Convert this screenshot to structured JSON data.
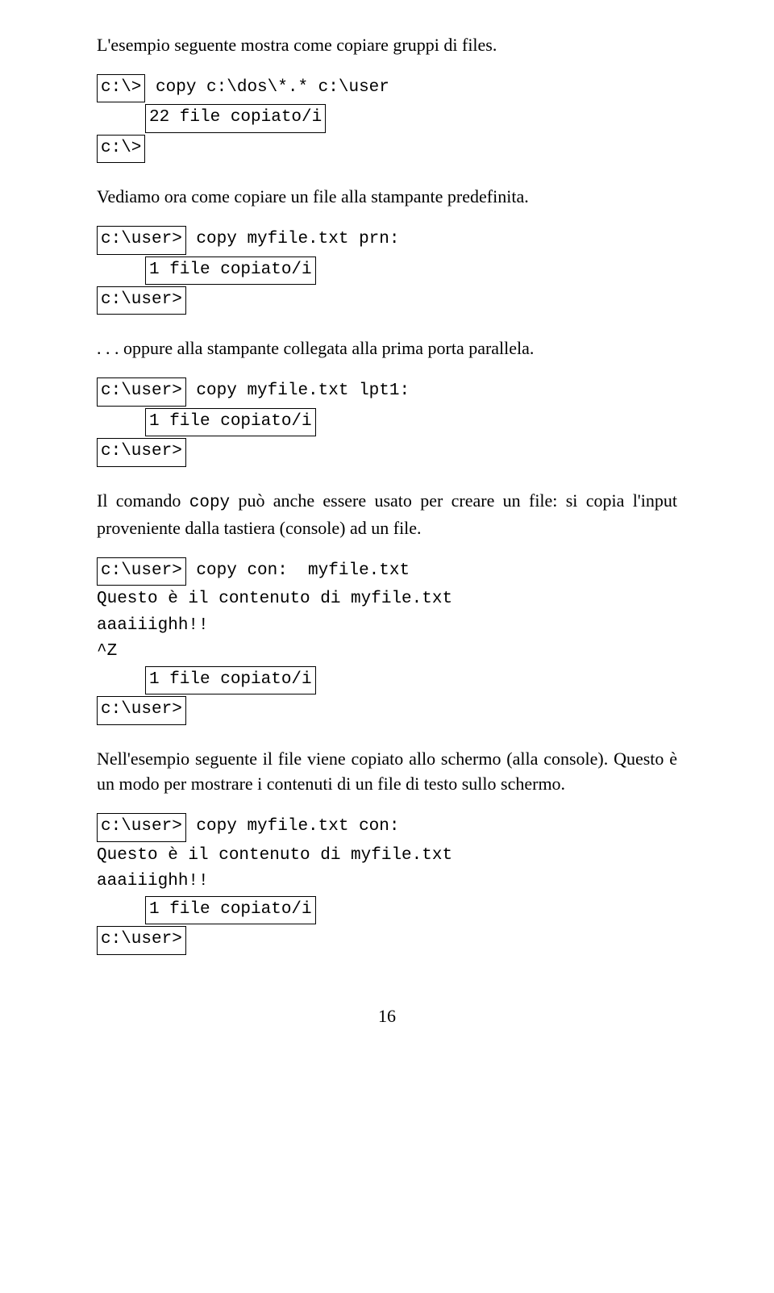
{
  "para1": "L'esempio seguente mostra come copiare gruppi di files.",
  "block1": {
    "prompt1": "c:\\>",
    "after1": " copy c:\\dos\\*.* c:\\user",
    "result": "22 file copiato/i",
    "prompt2": "c:\\>"
  },
  "para2": "Vediamo ora come copiare un file alla stampante predefinita.",
  "block2": {
    "prompt1": "c:\\user>",
    "after1": " copy myfile.txt prn:",
    "result": "1 file copiato/i",
    "prompt2": "c:\\user>"
  },
  "para3": ". . . oppure alla stampante collegata alla prima porta parallela.",
  "block3": {
    "prompt1": "c:\\user>",
    "after1": " copy myfile.txt lpt1:",
    "result": "1 file copiato/i",
    "prompt2": "c:\\user>"
  },
  "para4": "Il comando copy può anche essere usato per creare un file: si copia l'input proveniente dalla tastiera (console) ad un file.",
  "block4": {
    "prompt1": "c:\\user>",
    "after1": " copy con:  myfile.txt",
    "typed1": "Questo è il contenuto di myfile.txt",
    "typed2": "aaaiiighh!!",
    "typed3": "^Z",
    "result": "1 file copiato/i",
    "prompt2": "c:\\user>"
  },
  "para5": "Nell'esempio seguente il file viene copiato allo schermo (alla console). Questo è un modo per mostrare i contenuti di un file di testo sullo schermo.",
  "block5": {
    "prompt1": "c:\\user>",
    "after1": " copy myfile.txt con:",
    "typed1": "Questo è il contenuto di myfile.txt",
    "typed2": "aaaiiighh!!",
    "result": "1 file copiato/i",
    "prompt2": "c:\\user>"
  },
  "pagenum": "16"
}
